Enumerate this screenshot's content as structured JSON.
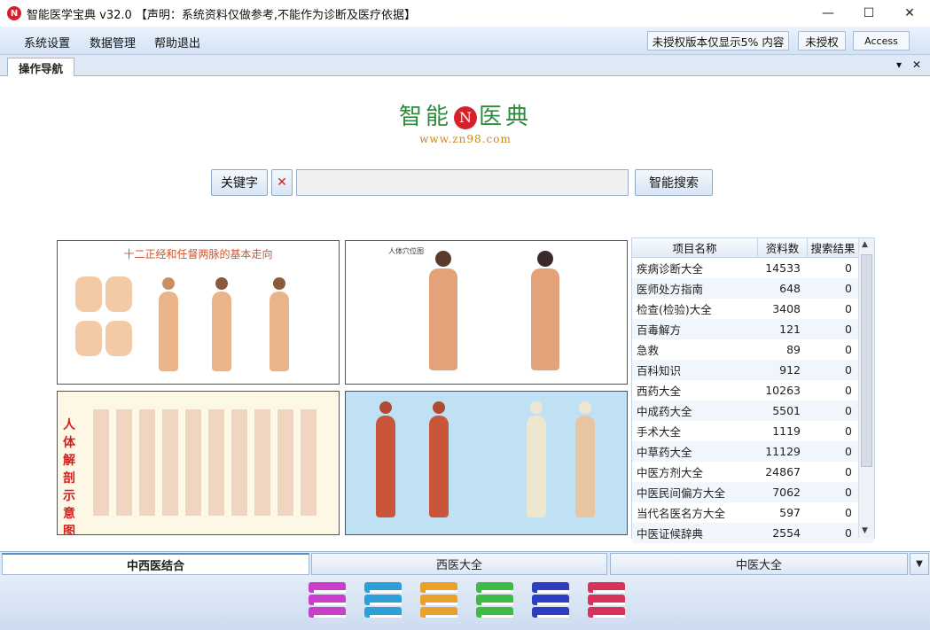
{
  "window": {
    "title": "智能医学宝典 v32.0 【声明：系统资料仅做参考,不能作为诊断及医疗依据】",
    "app_icon": "red-logo-icon",
    "controls": [
      "—",
      "☐",
      "✕"
    ]
  },
  "menu": {
    "items": [
      "系统设置",
      "数据管理",
      "帮助退出"
    ],
    "status": [
      "未授权版本仅显示5% 内容",
      "未授权",
      "Access"
    ]
  },
  "nav_tab": {
    "label": "操作导航",
    "controls": [
      "▾",
      "✕"
    ]
  },
  "logo": {
    "chars_left": "智能",
    "circle": "N",
    "chars_right": "医典",
    "url": "www.zn98.com"
  },
  "search": {
    "keyword_label": "关键字",
    "clear_label": "✕",
    "value": "",
    "button_label": "智能搜索"
  },
  "panels": [
    {
      "caption": "十二正经和任督两脉的基本走向"
    },
    {
      "caption": "人体穴位图"
    },
    {
      "caption": "人体解剖示意图"
    },
    {
      "caption": ""
    }
  ],
  "table": {
    "headers": [
      "项目名称",
      "资料数",
      "搜索结果"
    ],
    "rows": [
      [
        "疾病诊断大全",
        "14533",
        "0"
      ],
      [
        "医师处方指南",
        "648",
        "0"
      ],
      [
        "检查(检验)大全",
        "3408",
        "0"
      ],
      [
        "百毒解方",
        "121",
        "0"
      ],
      [
        "急救",
        "89",
        "0"
      ],
      [
        "百科知识",
        "912",
        "0"
      ],
      [
        "西药大全",
        "10263",
        "0"
      ],
      [
        "中成药大全",
        "5501",
        "0"
      ],
      [
        "手术大全",
        "1119",
        "0"
      ],
      [
        "中草药大全",
        "11129",
        "0"
      ],
      [
        "中医方剂大全",
        "24867",
        "0"
      ],
      [
        "中医民间偏方大全",
        "7062",
        "0"
      ],
      [
        "当代名医名方大全",
        "597",
        "0"
      ],
      [
        "中医证候辞典",
        "2554",
        "0"
      ]
    ]
  },
  "bottom_tabs": [
    "中西医结合",
    "西医大全",
    "中医大全"
  ],
  "books": [
    {
      "color": "#c93fc9",
      "icon": "book-stack-icon"
    },
    {
      "color": "#2f9fd8",
      "icon": "book-stack-icon"
    },
    {
      "color": "#e8a12a",
      "icon": "book-stack-icon"
    },
    {
      "color": "#3dbb45",
      "icon": "book-stack-icon"
    },
    {
      "color": "#2c3fc0",
      "icon": "book-stack-icon"
    },
    {
      "color": "#d8325a",
      "icon": "book-stack-icon"
    }
  ]
}
